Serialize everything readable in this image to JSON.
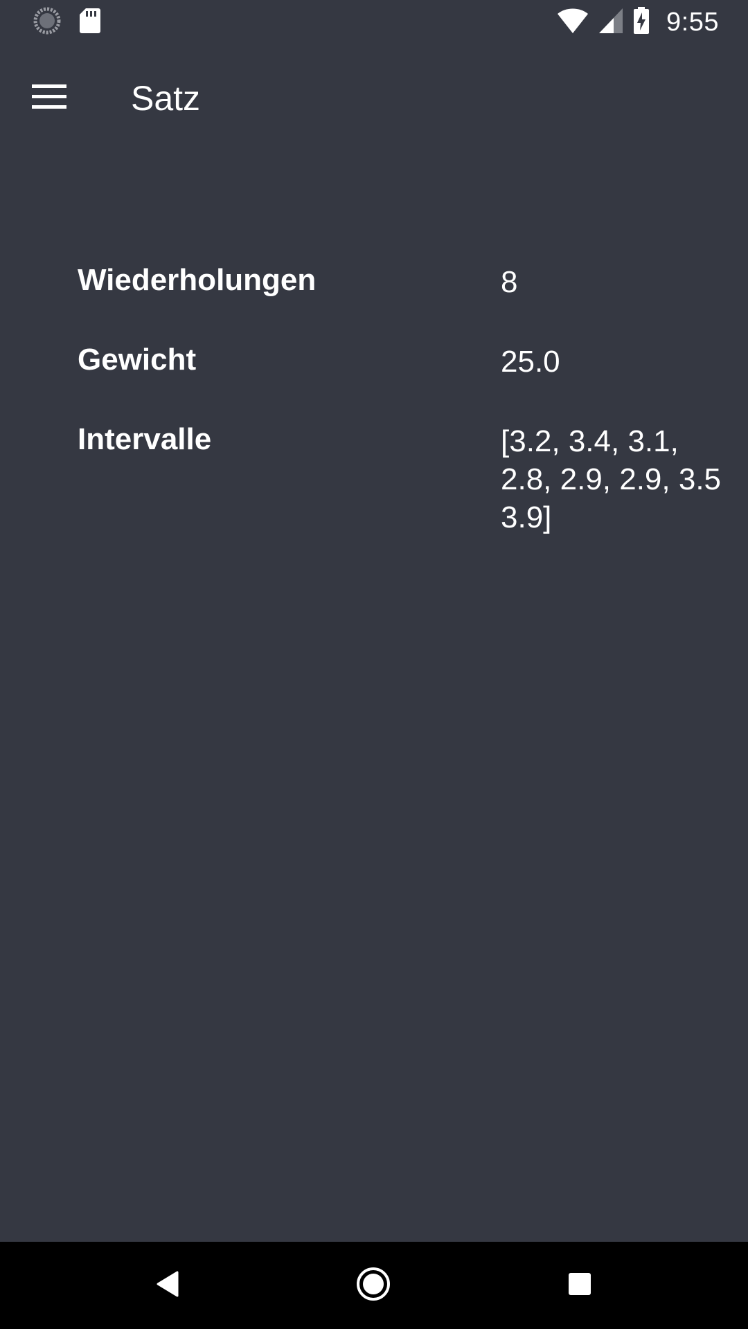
{
  "status_bar": {
    "time": "9:55",
    "icons": [
      "sync-icon",
      "sd-card-icon",
      "wifi-icon",
      "cell-signal-icon",
      "battery-charging-icon"
    ]
  },
  "app_bar": {
    "menu_icon": "hamburger-menu-icon",
    "title": "Satz"
  },
  "details": {
    "rows": [
      {
        "label": "Wiederholungen",
        "value": "8"
      },
      {
        "label": "Gewicht",
        "value": "25.0"
      },
      {
        "label": "Intervalle",
        "value": "[3.2, 3.4, 3.1, 2.8, 2.9, 2.9, 3.5 3.9]"
      }
    ]
  },
  "nav_bar": {
    "icons": [
      "back-icon",
      "home-icon",
      "recents-icon"
    ]
  },
  "colors": {
    "background": "#353842",
    "text": "#ffffff",
    "nav_background": "#000000"
  }
}
